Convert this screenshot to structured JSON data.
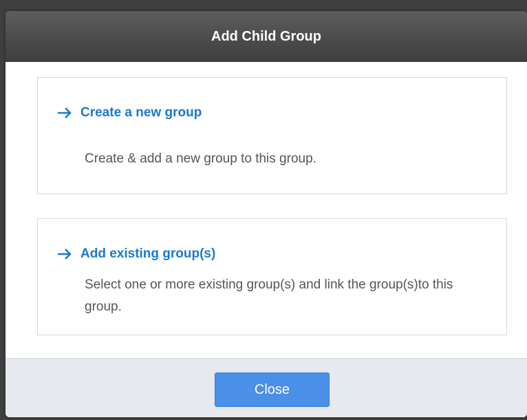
{
  "dialog": {
    "title": "Add Child Group"
  },
  "options": [
    {
      "title": "Create a new group",
      "description": "Create & add a new group to this group."
    },
    {
      "title": "Add existing group(s)",
      "description": "Select one or more existing group(s) and link the group(s)to this group."
    }
  ],
  "footer": {
    "close_label": "Close"
  },
  "colors": {
    "header_bg": "#4a4a4a",
    "link_blue": "#1a78d2",
    "button_blue": "#4a8fe8",
    "footer_bg": "#e6e9ed"
  },
  "icons": {
    "option_arrow": "arrow-right-icon"
  }
}
